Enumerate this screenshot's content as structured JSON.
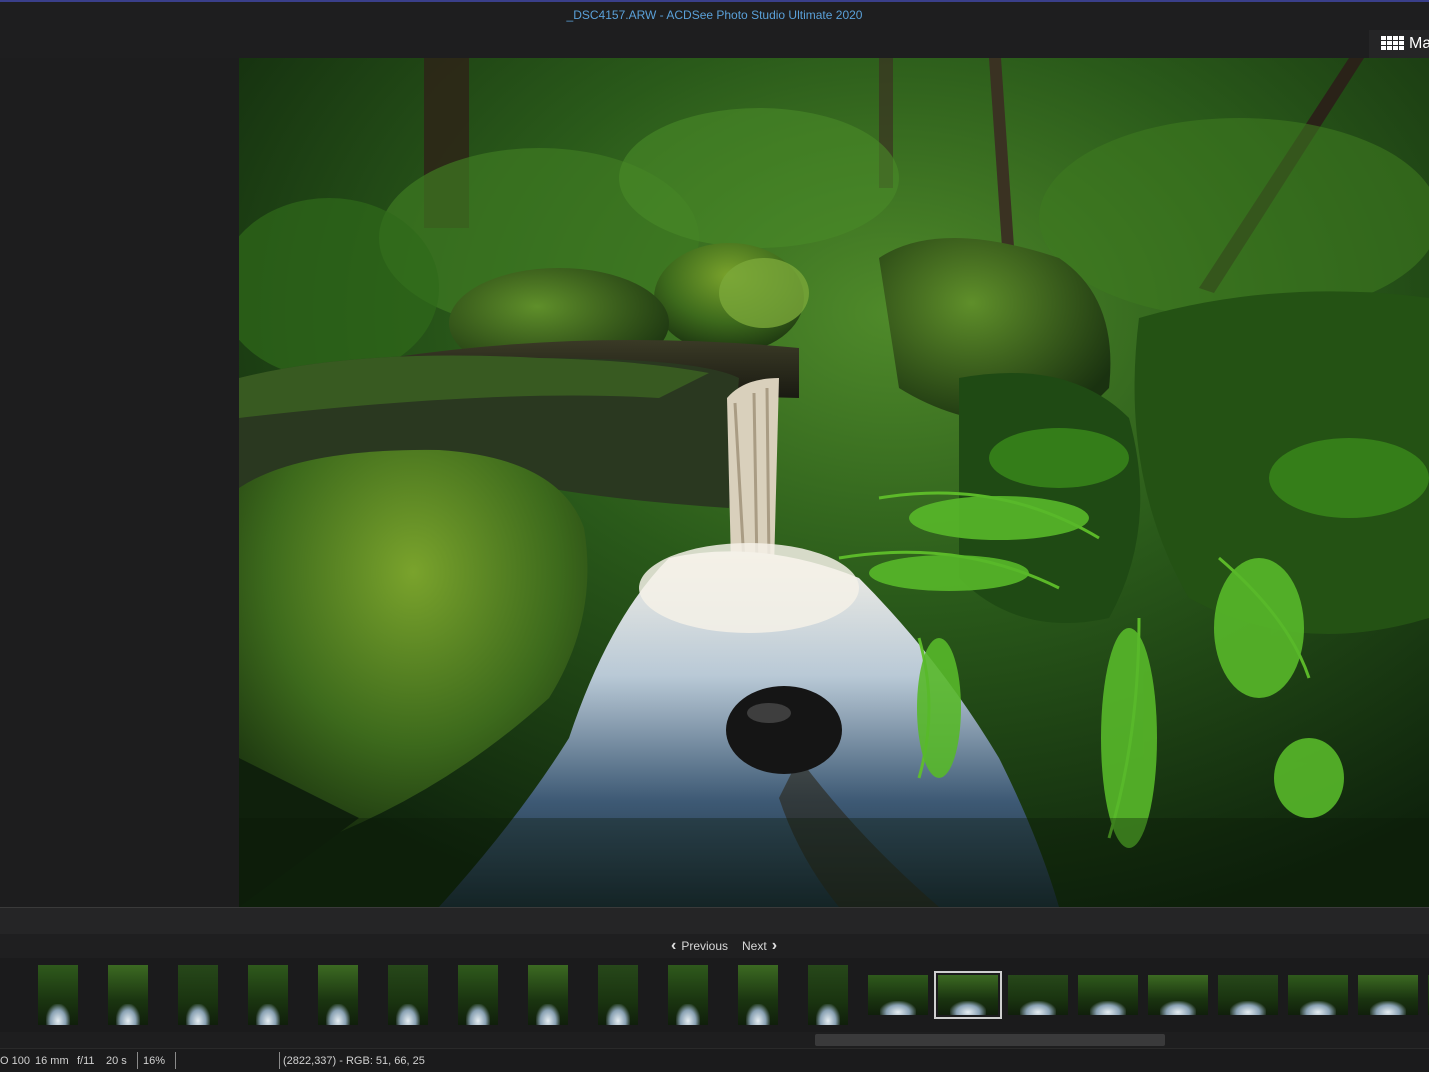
{
  "window": {
    "title": "_DSC4157.ARW - ACDSee Photo Studio Ultimate 2020"
  },
  "toolbar": {
    "mode_label": "Ma",
    "mode_icon": "grid-icon"
  },
  "navigation": {
    "previous_label": "Previous",
    "next_label": "Next"
  },
  "filmstrip": {
    "thumbnails": [
      {
        "orientation": "portrait"
      },
      {
        "orientation": "portrait"
      },
      {
        "orientation": "portrait"
      },
      {
        "orientation": "portrait"
      },
      {
        "orientation": "portrait"
      },
      {
        "orientation": "portrait"
      },
      {
        "orientation": "portrait"
      },
      {
        "orientation": "portrait"
      },
      {
        "orientation": "portrait"
      },
      {
        "orientation": "portrait"
      },
      {
        "orientation": "portrait"
      },
      {
        "orientation": "portrait"
      },
      {
        "orientation": "landscape"
      },
      {
        "orientation": "landscape",
        "selected": true
      },
      {
        "orientation": "landscape"
      },
      {
        "orientation": "landscape"
      },
      {
        "orientation": "landscape"
      },
      {
        "orientation": "landscape"
      },
      {
        "orientation": "landscape"
      },
      {
        "orientation": "landscape"
      },
      {
        "orientation": "landscape"
      }
    ]
  },
  "status": {
    "iso": "O 100",
    "focal_length": "16 mm",
    "aperture": "f/11",
    "exposure": "20 s",
    "zoom": "16%",
    "pixel_info": "(2822,337) - RGB: 51, 66, 25"
  },
  "colors": {
    "title_text": "#5aa0d8",
    "accent": "#3a3f8a"
  }
}
